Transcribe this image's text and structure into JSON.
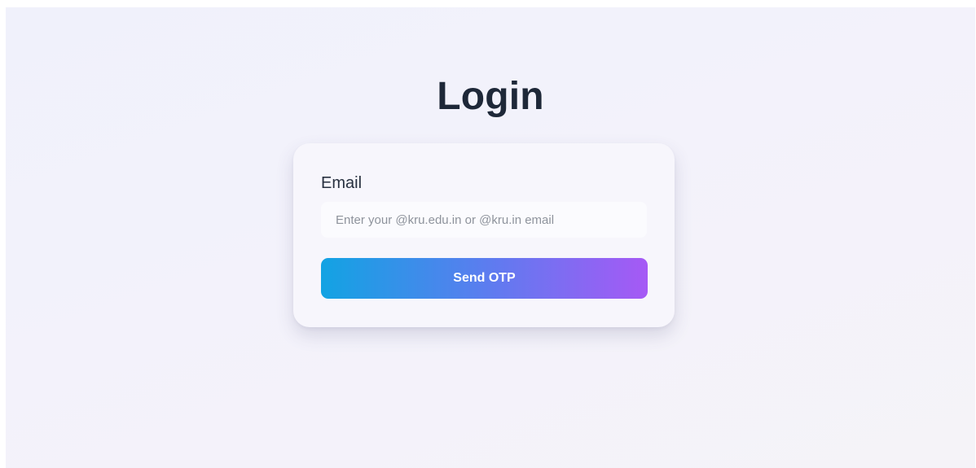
{
  "page": {
    "title": "Login"
  },
  "login_form": {
    "email_label": "Email",
    "email_value": "",
    "email_placeholder": "Enter your @kru.edu.in or @kru.in email",
    "submit_label": "Send OTP"
  },
  "colors": {
    "title_text": "#1e2838",
    "button_gradient_start": "#12a3e3",
    "button_gradient_end": "#a659f5",
    "card_background": "#f7f6fc"
  }
}
